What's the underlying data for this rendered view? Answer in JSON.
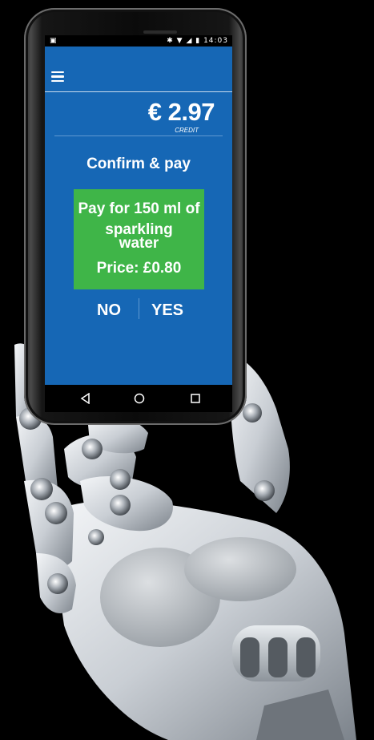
{
  "status_bar": {
    "time": "14:03",
    "left_icon": "image-notification-icon",
    "right_icons": [
      "bluetooth-icon",
      "wifi-icon",
      "signal-icon",
      "battery-charging-icon"
    ]
  },
  "header": {
    "menu_icon": "hamburger-menu-icon",
    "credit_amount": "€ 2.97",
    "credit_label": "CREDIT"
  },
  "confirm": {
    "title": "Confirm & pay",
    "line1": "Pay for 150 ml of",
    "line2": "sparkling",
    "line3": "water",
    "price": "Price: £0.80",
    "no_label": "NO",
    "yes_label": "YES"
  },
  "nav_bar": {
    "icons": [
      "back-icon",
      "home-icon",
      "recent-apps-icon"
    ]
  },
  "colors": {
    "screen_bg": "#1667b5",
    "pay_box_bg": "#3fb548",
    "text": "#ffffff",
    "page_bg": "#000000"
  }
}
